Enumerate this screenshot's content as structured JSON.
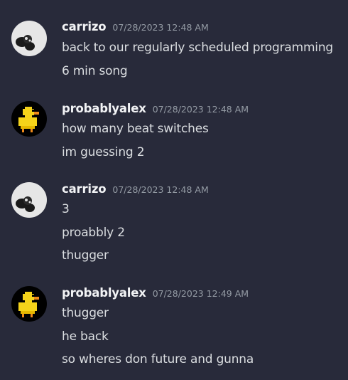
{
  "messages": [
    {
      "author": "carrizo",
      "avatar_icon": "grey-cartoon-avatar",
      "timestamp": "07/28/2023 12:48 AM",
      "lines": [
        "back to our regularly scheduled programming",
        "6 min song"
      ]
    },
    {
      "author": "probablyalex",
      "avatar_icon": "pixel-duck-avatar",
      "timestamp": "07/28/2023 12:48 AM",
      "lines": [
        "how many beat switches",
        "im guessing 2"
      ]
    },
    {
      "author": "carrizo",
      "avatar_icon": "grey-cartoon-avatar",
      "timestamp": "07/28/2023 12:48 AM",
      "lines": [
        "3",
        "proabbly 2",
        "thugger"
      ]
    },
    {
      "author": "probablyalex",
      "avatar_icon": "pixel-duck-avatar",
      "timestamp": "07/28/2023 12:49 AM",
      "lines": [
        "thugger",
        "he back",
        "so wheres don future and gunna"
      ]
    }
  ],
  "colors": {
    "background": "#282a3a",
    "username": "#f2f3f5",
    "timestamp": "#949ba4",
    "message_text": "#dbdee1"
  }
}
